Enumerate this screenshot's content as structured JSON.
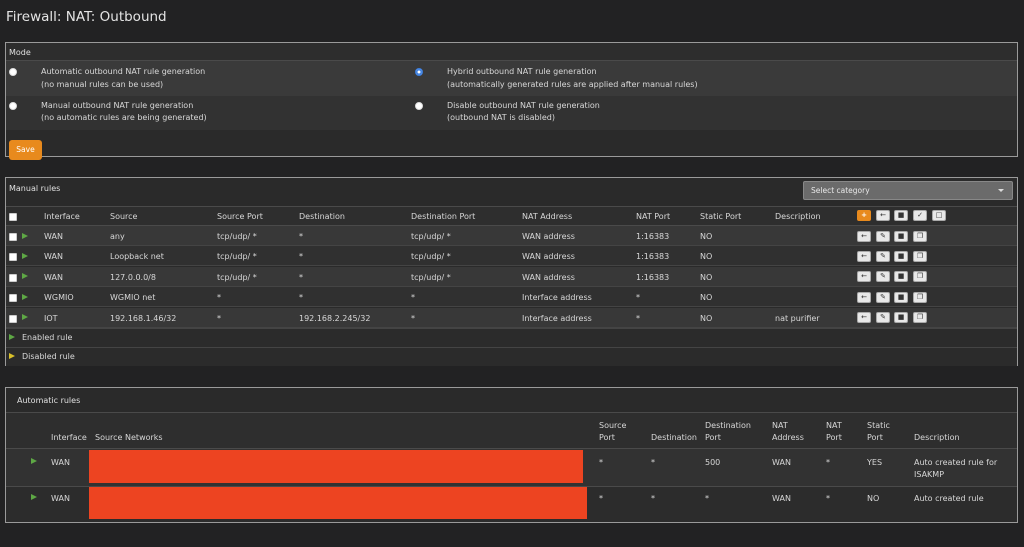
{
  "page": {
    "title": "Firewall: NAT: Outbound"
  },
  "mode": {
    "header": "Mode",
    "options": [
      {
        "label": "Automatic outbound NAT rule generation",
        "sub": "(no manual rules can be used)",
        "checked": false
      },
      {
        "label": "Hybrid outbound NAT rule generation",
        "sub": "(automatically generated rules are applied after manual rules)",
        "checked": true
      },
      {
        "label": "Manual outbound NAT rule generation",
        "sub": "(no automatic rules are being generated)",
        "checked": false
      },
      {
        "label": "Disable outbound NAT rule generation",
        "sub": "(outbound NAT is disabled)",
        "checked": false
      }
    ],
    "save_label": "Save"
  },
  "manual": {
    "header": "Manual rules",
    "category_placeholder": "Select category",
    "columns": [
      "Interface",
      "Source",
      "Source Port",
      "Destination",
      "Destination Port",
      "NAT Address",
      "NAT Port",
      "Static Port",
      "Description"
    ],
    "rows": [
      [
        "WAN",
        "any",
        "tcp/udp/ *",
        "*",
        "tcp/udp/ *",
        "WAN address",
        "1:16383",
        "NO",
        ""
      ],
      [
        "WAN",
        "Loopback net",
        "tcp/udp/ *",
        "*",
        "tcp/udp/ *",
        "WAN address",
        "1:16383",
        "NO",
        ""
      ],
      [
        "WAN",
        "127.0.0.0/8",
        "tcp/udp/ *",
        "*",
        "tcp/udp/ *",
        "WAN address",
        "1:16383",
        "NO",
        ""
      ],
      [
        "WGMIO",
        "WGMIO net",
        "*",
        "*",
        "*",
        "Interface address",
        "*",
        "NO",
        ""
      ],
      [
        "IOT",
        "192.168.1.46/32",
        "*",
        "192.168.2.245/32",
        "*",
        "Interface address",
        "*",
        "NO",
        "nat purifier"
      ]
    ],
    "legend": {
      "enabled": "Enabled rule",
      "disabled": "Disabled rule"
    },
    "header_buttons": [
      "plus-icon",
      "arrow-left-icon",
      "trash-icon",
      "check-square-icon",
      "square-icon"
    ],
    "row_buttons": [
      "arrow-left-icon",
      "pencil-icon",
      "trash-icon",
      "copy-icon"
    ]
  },
  "automatic": {
    "header": "Automatic rules",
    "columns": {
      "interface": "Interface",
      "source_networks": "Source Networks",
      "source_port": [
        "Source",
        "Port"
      ],
      "destination": "Destination",
      "destination_port": [
        "Destination",
        "Port"
      ],
      "nat_address": [
        "NAT",
        "Address"
      ],
      "nat_port": [
        "NAT",
        "Port"
      ],
      "static_port": [
        "Static",
        "Port"
      ],
      "description": "Description"
    },
    "rows": [
      {
        "interface": "WAN",
        "source_port": "*",
        "destination": "*",
        "destination_port": "500",
        "nat_address": "WAN",
        "nat_port": "*",
        "static_port": "YES",
        "description": [
          "Auto created rule for",
          "ISAKMP"
        ]
      },
      {
        "interface": "WAN",
        "source_port": "*",
        "destination": "*",
        "destination_port": "*",
        "nat_address": "WAN",
        "nat_port": "*",
        "static_port": "NO",
        "description": [
          "Auto created rule"
        ]
      }
    ],
    "redaction_color": "#ed4421"
  },
  "colors": {
    "accent": "#e88a1d",
    "enabled": "#5ea845",
    "disabled": "#d8c02a"
  }
}
